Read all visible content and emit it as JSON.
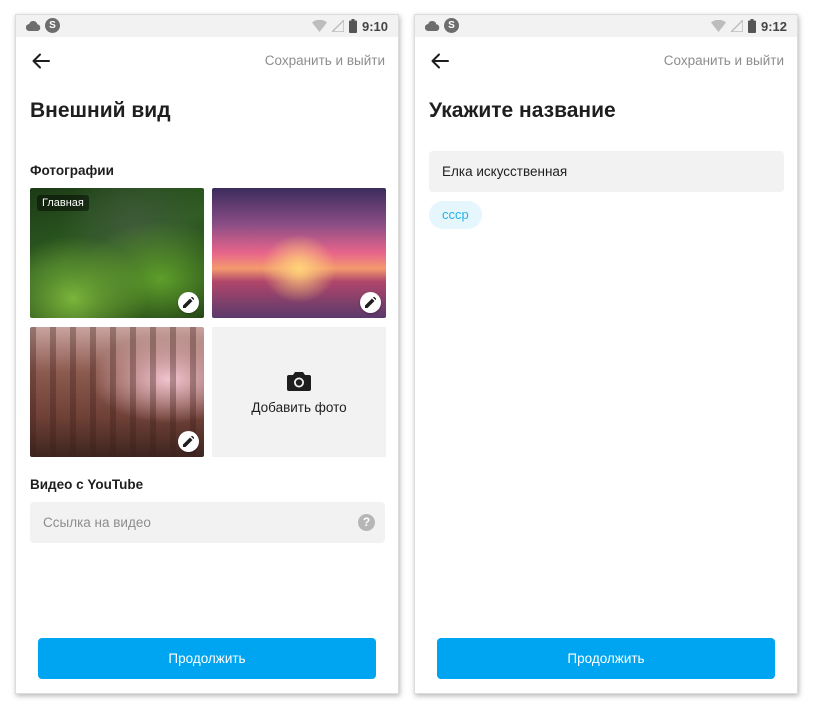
{
  "screens": [
    {
      "status_time": "9:10",
      "app_badge": "S",
      "save_exit": "Сохранить и выйти",
      "title": "Внешний вид",
      "photos_section": "Фотографии",
      "main_label": "Главная",
      "add_photo": "Добавить фото",
      "video_section": "Видео с YouTube",
      "video_placeholder": "Ссылка на видео",
      "help": "?",
      "continue": "Продолжить"
    },
    {
      "status_time": "9:12",
      "app_badge": "S",
      "save_exit": "Сохранить и выйти",
      "title": "Укажите название",
      "name_value": "Елка искусственная",
      "suggestion": "ссср",
      "continue": "Продолжить"
    }
  ],
  "colors": {
    "accent": "#00a5f2",
    "chip_bg": "#e6f6fd",
    "chip_text": "#27b1e3",
    "field_bg": "#f2f2f2",
    "muted_text": "#8d8d8d"
  },
  "icons": [
    "cloud-icon",
    "app-icon",
    "wifi-icon",
    "signal-icon",
    "battery-icon",
    "back-arrow-icon",
    "pencil-icon",
    "camera-icon",
    "help-icon"
  ]
}
